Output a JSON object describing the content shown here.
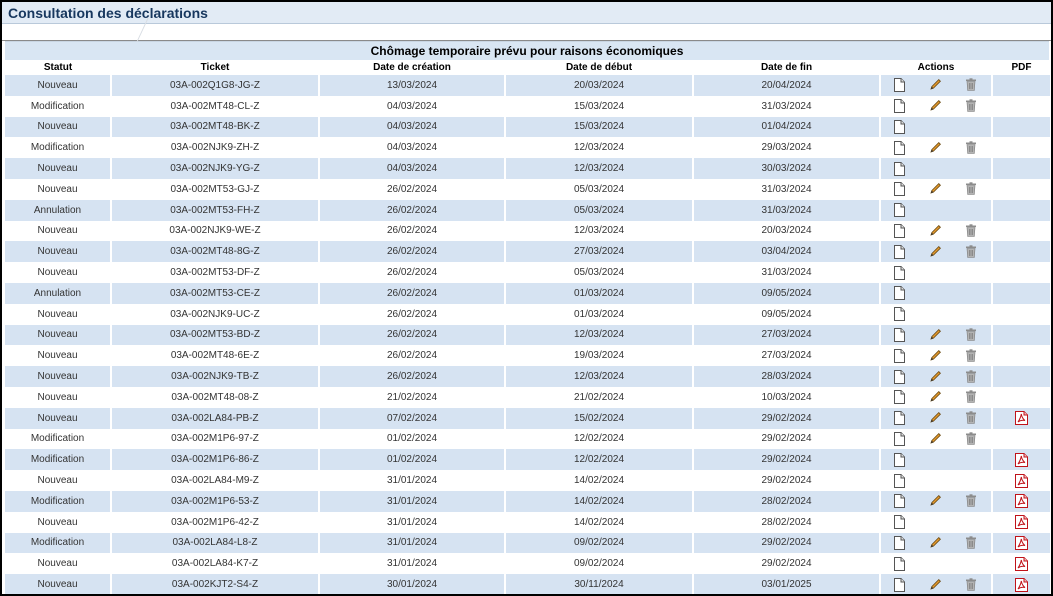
{
  "page": {
    "title": "Consultation des déclarations"
  },
  "table": {
    "caption": "Chômage temporaire prévu pour raisons économiques",
    "headers": {
      "statut": "Statut",
      "ticket": "Ticket",
      "creation": "Date de création",
      "debut": "Date de début",
      "fin": "Date de fin",
      "actions": "Actions",
      "pdf": "PDF"
    },
    "rows": [
      {
        "statut": "Nouveau",
        "ticket": "03A-002Q1G8-JG-Z",
        "creation": "13/03/2024",
        "debut": "20/03/2024",
        "fin": "20/04/2024",
        "view": true,
        "edit": true,
        "del": true,
        "pdf": false
      },
      {
        "statut": "Modification",
        "ticket": "03A-002MT48-CL-Z",
        "creation": "04/03/2024",
        "debut": "15/03/2024",
        "fin": "31/03/2024",
        "view": true,
        "edit": true,
        "del": true,
        "pdf": false
      },
      {
        "statut": "Nouveau",
        "ticket": "03A-002MT48-BK-Z",
        "creation": "04/03/2024",
        "debut": "15/03/2024",
        "fin": "01/04/2024",
        "view": true,
        "edit": false,
        "del": false,
        "pdf": false
      },
      {
        "statut": "Modification",
        "ticket": "03A-002NJK9-ZH-Z",
        "creation": "04/03/2024",
        "debut": "12/03/2024",
        "fin": "29/03/2024",
        "view": true,
        "edit": true,
        "del": true,
        "pdf": false
      },
      {
        "statut": "Nouveau",
        "ticket": "03A-002NJK9-YG-Z",
        "creation": "04/03/2024",
        "debut": "12/03/2024",
        "fin": "30/03/2024",
        "view": true,
        "edit": false,
        "del": false,
        "pdf": false
      },
      {
        "statut": "Nouveau",
        "ticket": "03A-002MT53-GJ-Z",
        "creation": "26/02/2024",
        "debut": "05/03/2024",
        "fin": "31/03/2024",
        "view": true,
        "edit": true,
        "del": true,
        "pdf": false
      },
      {
        "statut": "Annulation",
        "ticket": "03A-002MT53-FH-Z",
        "creation": "26/02/2024",
        "debut": "05/03/2024",
        "fin": "31/03/2024",
        "view": true,
        "edit": false,
        "del": false,
        "pdf": false
      },
      {
        "statut": "Nouveau",
        "ticket": "03A-002NJK9-WE-Z",
        "creation": "26/02/2024",
        "debut": "12/03/2024",
        "fin": "20/03/2024",
        "view": true,
        "edit": true,
        "del": true,
        "pdf": false
      },
      {
        "statut": "Nouveau",
        "ticket": "03A-002MT48-8G-Z",
        "creation": "26/02/2024",
        "debut": "27/03/2024",
        "fin": "03/04/2024",
        "view": true,
        "edit": true,
        "del": true,
        "pdf": false
      },
      {
        "statut": "Nouveau",
        "ticket": "03A-002MT53-DF-Z",
        "creation": "26/02/2024",
        "debut": "05/03/2024",
        "fin": "31/03/2024",
        "view": true,
        "edit": false,
        "del": false,
        "pdf": false
      },
      {
        "statut": "Annulation",
        "ticket": "03A-002MT53-CE-Z",
        "creation": "26/02/2024",
        "debut": "01/03/2024",
        "fin": "09/05/2024",
        "view": true,
        "edit": false,
        "del": false,
        "pdf": false
      },
      {
        "statut": "Nouveau",
        "ticket": "03A-002NJK9-UC-Z",
        "creation": "26/02/2024",
        "debut": "01/03/2024",
        "fin": "09/05/2024",
        "view": true,
        "edit": false,
        "del": false,
        "pdf": false
      },
      {
        "statut": "Nouveau",
        "ticket": "03A-002MT53-BD-Z",
        "creation": "26/02/2024",
        "debut": "12/03/2024",
        "fin": "27/03/2024",
        "view": true,
        "edit": true,
        "del": true,
        "pdf": false
      },
      {
        "statut": "Nouveau",
        "ticket": "03A-002MT48-6E-Z",
        "creation": "26/02/2024",
        "debut": "19/03/2024",
        "fin": "27/03/2024",
        "view": true,
        "edit": true,
        "del": true,
        "pdf": false
      },
      {
        "statut": "Nouveau",
        "ticket": "03A-002NJK9-TB-Z",
        "creation": "26/02/2024",
        "debut": "12/03/2024",
        "fin": "28/03/2024",
        "view": true,
        "edit": true,
        "del": true,
        "pdf": false
      },
      {
        "statut": "Nouveau",
        "ticket": "03A-002MT48-08-Z",
        "creation": "21/02/2024",
        "debut": "21/02/2024",
        "fin": "10/03/2024",
        "view": true,
        "edit": true,
        "del": true,
        "pdf": false
      },
      {
        "statut": "Nouveau",
        "ticket": "03A-002LA84-PB-Z",
        "creation": "07/02/2024",
        "debut": "15/02/2024",
        "fin": "29/02/2024",
        "view": true,
        "edit": true,
        "del": true,
        "pdf": true
      },
      {
        "statut": "Modification",
        "ticket": "03A-002M1P6-97-Z",
        "creation": "01/02/2024",
        "debut": "12/02/2024",
        "fin": "29/02/2024",
        "view": true,
        "edit": true,
        "del": true,
        "pdf": false
      },
      {
        "statut": "Modification",
        "ticket": "03A-002M1P6-86-Z",
        "creation": "01/02/2024",
        "debut": "12/02/2024",
        "fin": "29/02/2024",
        "view": true,
        "edit": false,
        "del": false,
        "pdf": true
      },
      {
        "statut": "Nouveau",
        "ticket": "03A-002LA84-M9-Z",
        "creation": "31/01/2024",
        "debut": "14/02/2024",
        "fin": "29/02/2024",
        "view": true,
        "edit": false,
        "del": false,
        "pdf": true
      },
      {
        "statut": "Modification",
        "ticket": "03A-002M1P6-53-Z",
        "creation": "31/01/2024",
        "debut": "14/02/2024",
        "fin": "28/02/2024",
        "view": true,
        "edit": true,
        "del": true,
        "pdf": true
      },
      {
        "statut": "Nouveau",
        "ticket": "03A-002M1P6-42-Z",
        "creation": "31/01/2024",
        "debut": "14/02/2024",
        "fin": "28/02/2024",
        "view": true,
        "edit": false,
        "del": false,
        "pdf": true
      },
      {
        "statut": "Modification",
        "ticket": "03A-002LA84-L8-Z",
        "creation": "31/01/2024",
        "debut": "09/02/2024",
        "fin": "29/02/2024",
        "view": true,
        "edit": true,
        "del": true,
        "pdf": true
      },
      {
        "statut": "Nouveau",
        "ticket": "03A-002LA84-K7-Z",
        "creation": "31/01/2024",
        "debut": "09/02/2024",
        "fin": "29/02/2024",
        "view": true,
        "edit": false,
        "del": false,
        "pdf": true
      },
      {
        "statut": "Nouveau",
        "ticket": "03A-002KJT2-S4-Z",
        "creation": "30/01/2024",
        "debut": "30/11/2024",
        "fin": "03/01/2025",
        "view": true,
        "edit": true,
        "del": true,
        "pdf": true
      }
    ]
  },
  "icons": {
    "view": "document-icon",
    "edit": "pencil-icon",
    "delete": "trash-icon",
    "pdf": "pdf-icon"
  }
}
